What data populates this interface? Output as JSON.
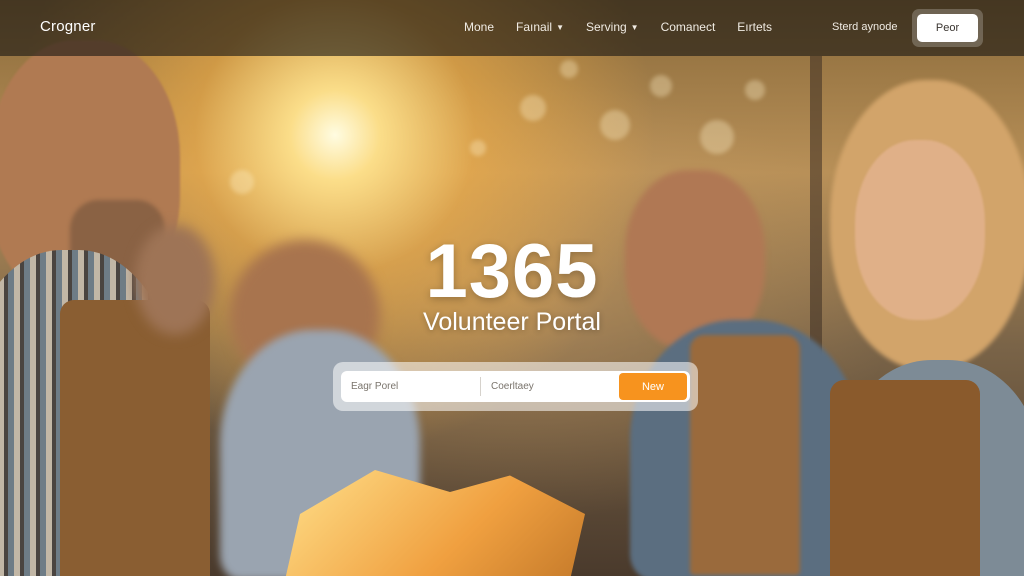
{
  "header": {
    "brand": "Crogner",
    "nav": [
      {
        "label": "Mone",
        "dropdown": false
      },
      {
        "label": "Faınail",
        "dropdown": true
      },
      {
        "label": "Serving",
        "dropdown": true
      },
      {
        "label": "Comanect",
        "dropdown": false
      },
      {
        "label": "Eırtets",
        "dropdown": false
      }
    ],
    "signin_label": "Sterd aynode",
    "button_label": "Peor"
  },
  "hero": {
    "headline": "1365",
    "subline": "Volunteer Portal"
  },
  "search": {
    "field1_placeholder": "Eagr Porel",
    "field2_placeholder": "Coerltaey",
    "button_label": "New"
  },
  "colors": {
    "accent": "#f7931e",
    "topbar": "#1c1814",
    "text": "#ffffff"
  }
}
